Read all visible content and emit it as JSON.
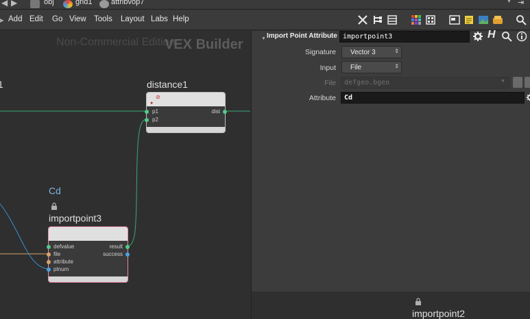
{
  "pathbar": {
    "crumbs": [
      "obj",
      "grid1",
      "attribvop7"
    ]
  },
  "menubar": {
    "items": [
      "Add",
      "Edit",
      "Go",
      "View",
      "Tools",
      "Layout",
      "Labs",
      "Help"
    ]
  },
  "network": {
    "watermark": "Non-Commercial Edition",
    "context_label": "VEX Builder",
    "left_edge_label": "1",
    "nodes": {
      "distance": {
        "name": "distance1",
        "inputs": [
          "p1",
          "p2"
        ],
        "outputs": [
          "dist"
        ]
      },
      "importpoint3": {
        "comment": "Cd",
        "name": "importpoint3",
        "inputs": [
          "defvalue",
          "file",
          "attribute",
          "ptnum"
        ],
        "outputs": [
          "result",
          "success"
        ]
      },
      "importpoint2": {
        "name": "importpoint2"
      }
    }
  },
  "params": {
    "node_type": "Import Point Attribute",
    "node_name": "importpoint3",
    "rows": {
      "signature": {
        "label": "Signature",
        "value": "Vector 3"
      },
      "input": {
        "label": "Input",
        "value": "File"
      },
      "file": {
        "label": "File",
        "value": "defgeo.bgeo"
      },
      "attribute": {
        "label": "Attribute",
        "value": "Cd"
      }
    }
  },
  "colors": {
    "wire_green": "#3aa878",
    "wire_blue": "#3a8fd0",
    "port_green": "#53c98a",
    "port_blue": "#4aa3e0",
    "port_orange": "#d9a46a",
    "node_selected_border": "#e88aa8",
    "comment_blue": "#7fb2e0"
  }
}
